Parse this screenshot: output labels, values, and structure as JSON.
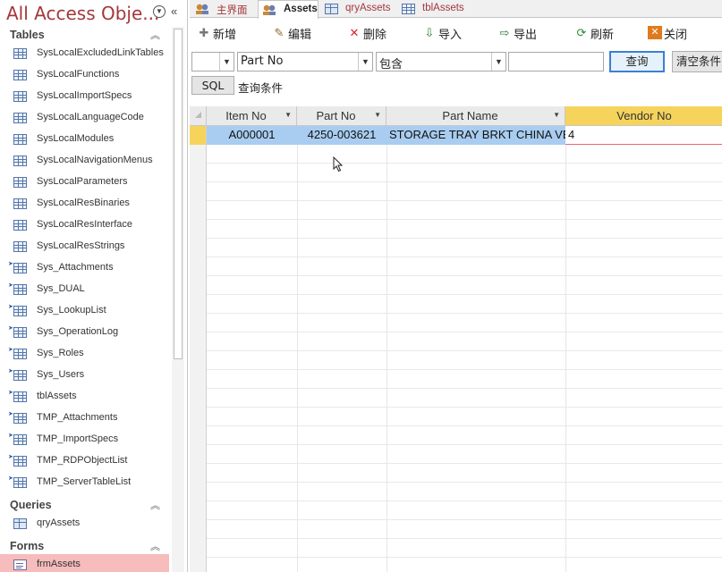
{
  "nav": {
    "title": "All Access Obje...",
    "sections": [
      {
        "label": "Tables",
        "items": [
          {
            "label": "SysLocalExcludedLinkTables",
            "icon": "table-icon",
            "linked": false
          },
          {
            "label": "SysLocalFunctions",
            "icon": "table-icon",
            "linked": false
          },
          {
            "label": "SysLocalImportSpecs",
            "icon": "table-icon",
            "linked": false
          },
          {
            "label": "SysLocalLanguageCode",
            "icon": "table-icon",
            "linked": false
          },
          {
            "label": "SysLocalModules",
            "icon": "table-icon",
            "linked": false
          },
          {
            "label": "SysLocalNavigationMenus",
            "icon": "table-icon",
            "linked": false
          },
          {
            "label": "SysLocalParameters",
            "icon": "table-icon",
            "linked": false
          },
          {
            "label": "SysLocalResBinaries",
            "icon": "table-icon",
            "linked": false
          },
          {
            "label": "SysLocalResInterface",
            "icon": "table-icon",
            "linked": false
          },
          {
            "label": "SysLocalResStrings",
            "icon": "table-icon",
            "linked": false
          },
          {
            "label": "Sys_Attachments",
            "icon": "linked-table-icon",
            "linked": true
          },
          {
            "label": "Sys_DUAL",
            "icon": "linked-table-icon",
            "linked": true
          },
          {
            "label": "Sys_LookupList",
            "icon": "linked-table-icon",
            "linked": true
          },
          {
            "label": "Sys_OperationLog",
            "icon": "linked-table-icon",
            "linked": true
          },
          {
            "label": "Sys_Roles",
            "icon": "linked-table-icon",
            "linked": true
          },
          {
            "label": "Sys_Users",
            "icon": "linked-table-icon",
            "linked": true
          },
          {
            "label": "tblAssets",
            "icon": "linked-table-icon",
            "linked": true
          },
          {
            "label": "TMP_Attachments",
            "icon": "linked-table-icon",
            "linked": true
          },
          {
            "label": "TMP_ImportSpecs",
            "icon": "linked-table-icon",
            "linked": true
          },
          {
            "label": "TMP_RDPObjectList",
            "icon": "linked-table-icon",
            "linked": true
          },
          {
            "label": "TMP_ServerTableList",
            "icon": "linked-table-icon",
            "linked": true
          }
        ]
      },
      {
        "label": "Queries",
        "items": [
          {
            "label": "qryAssets",
            "icon": "query-icon",
            "linked": false
          }
        ]
      },
      {
        "label": "Forms",
        "items": [
          {
            "label": "frmAssets",
            "icon": "form-icon",
            "linked": false,
            "selected": true
          }
        ]
      }
    ]
  },
  "tabs": [
    {
      "label": "主界面",
      "icon": "users-icon",
      "active": false
    },
    {
      "label": "Assets",
      "icon": "users-icon",
      "active": true
    },
    {
      "label": "qryAssets",
      "icon": "query-icon",
      "active": false
    },
    {
      "label": "tblAssets",
      "icon": "table-icon",
      "active": false
    }
  ],
  "toolbar": {
    "new_label": "新增",
    "edit_label": "编辑",
    "delete_label": "删除",
    "import_label": "导入",
    "export_label": "导出",
    "refresh_label": "刷新",
    "close_label": "关闭"
  },
  "filter": {
    "logic_value": "",
    "field_value": "Part No",
    "operator_value": "包含",
    "search_value": "",
    "query_label": "查询",
    "clear_label": "清空条件",
    "sql_label": "SQL",
    "condition_label": "查询条件"
  },
  "grid": {
    "columns": [
      "Item No",
      "Part No",
      "Part Name",
      "Vendor No"
    ],
    "selected_column": 3,
    "rows": [
      [
        "A000001",
        "4250-003621",
        "STORAGE TRAY BRKT CHINA VE",
        "4"
      ]
    ]
  },
  "colors": {
    "accent": "#a4373a",
    "selected_nav": "#f7bcbc",
    "selected_column": "#f6d35b",
    "selected_row": "#a9cdf0"
  }
}
